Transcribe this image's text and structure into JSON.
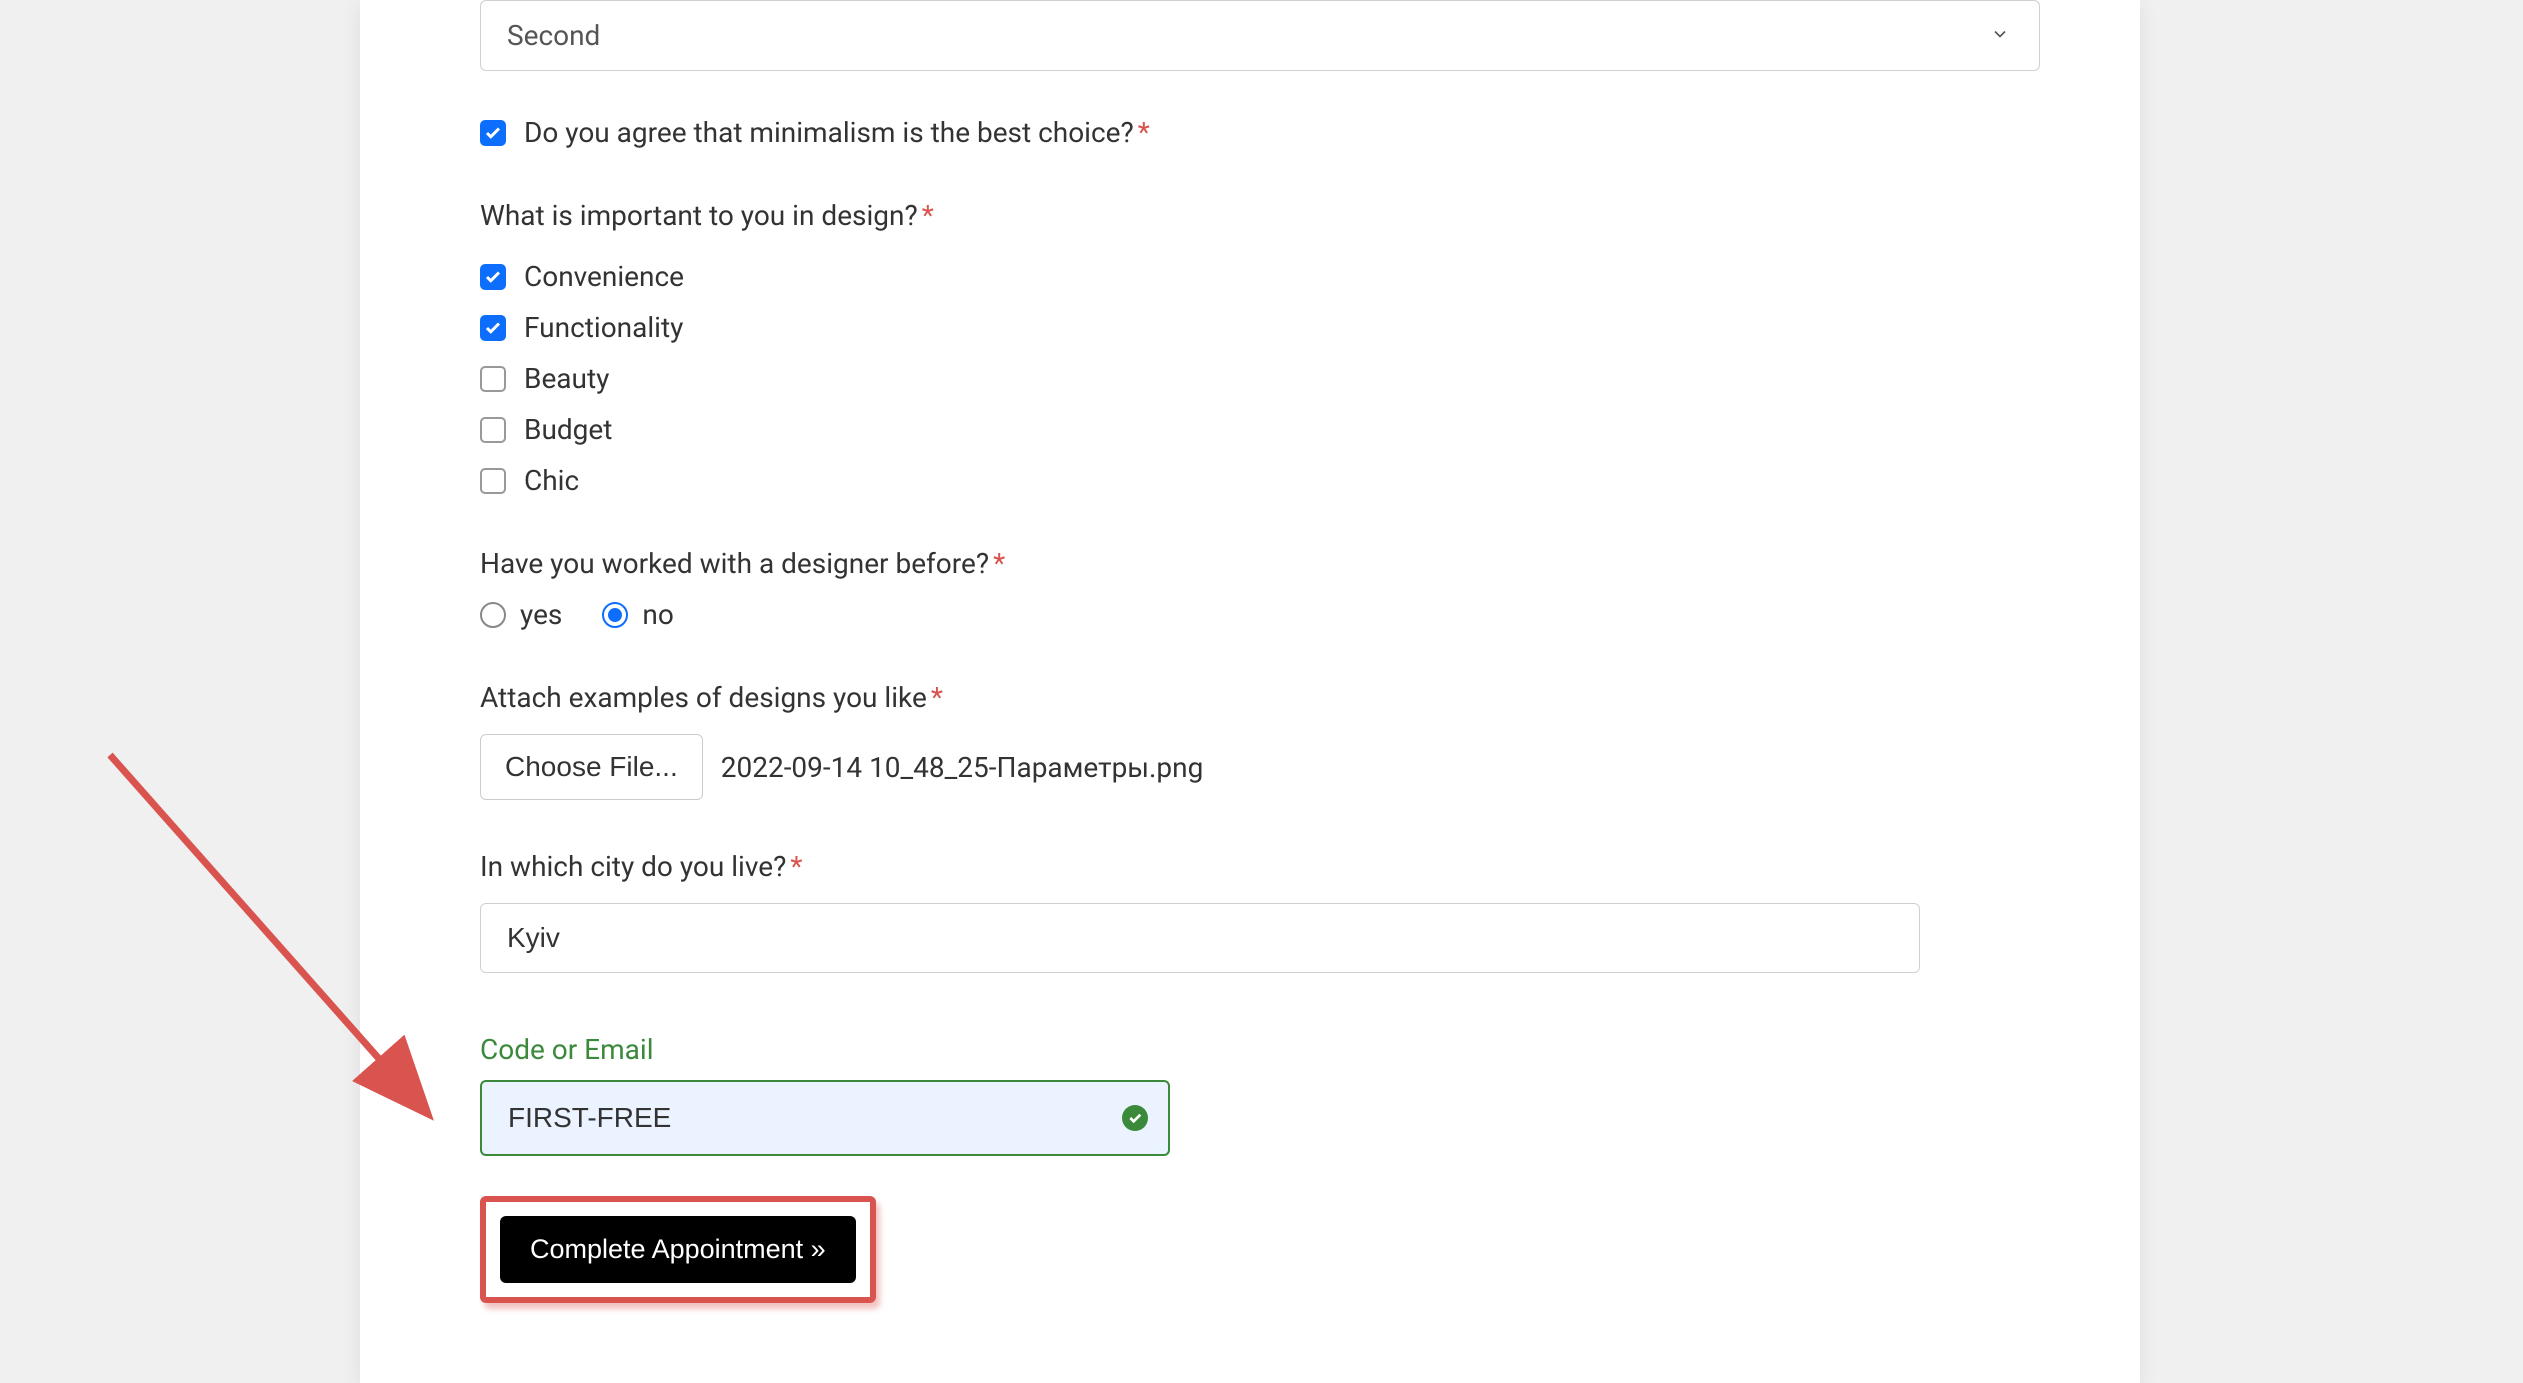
{
  "select": {
    "value": "Second"
  },
  "agree_minimalism": {
    "label": "Do you agree that minimalism is the best choice?",
    "checked": true
  },
  "design_importance": {
    "label": "What is important to you in design?",
    "options": [
      {
        "label": "Convenience",
        "checked": true
      },
      {
        "label": "Functionality",
        "checked": true
      },
      {
        "label": "Beauty",
        "checked": false
      },
      {
        "label": "Budget",
        "checked": false
      },
      {
        "label": "Chic",
        "checked": false
      }
    ]
  },
  "designer_before": {
    "label": "Have you worked with a designer before?",
    "options": [
      {
        "label": "yes",
        "selected": false
      },
      {
        "label": "no",
        "selected": true
      }
    ]
  },
  "attach": {
    "label": "Attach examples of designs you like",
    "button": "Choose File...",
    "filename": "2022-09-14 10_48_25-Параметры.png"
  },
  "city": {
    "label": "In which city do you live?",
    "value": "Kyiv"
  },
  "code": {
    "label": "Code or Email",
    "value": "FIRST-FREE"
  },
  "submit": {
    "label": "Complete Appointment »"
  }
}
